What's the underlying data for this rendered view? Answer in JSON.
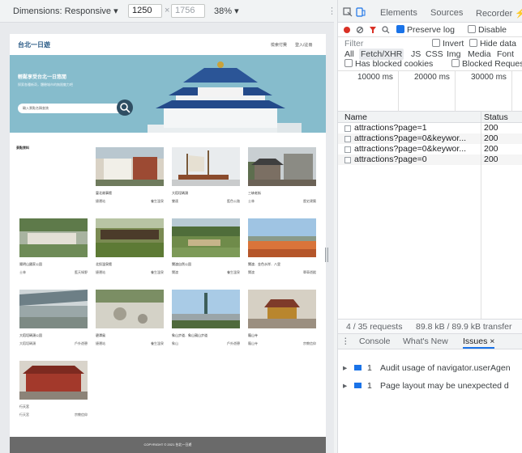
{
  "device_toolbar": {
    "dimensions_label": "Dimensions: Responsive ▾",
    "width_value": "1250",
    "times_sign": "×",
    "height_placeholder": "1756",
    "zoom_label": "38% ▾"
  },
  "site": {
    "logo": "台北一日遊",
    "nav": [
      "檢索付費",
      "登入/註冊"
    ],
    "hero_title": "輕鬆享受台北一日悠閒",
    "hero_subtitle": "探索各種新奇，體驗城市的無限魅力吧",
    "search_placeholder": "輸入景點名稱查詢",
    "section_title": "景點資料",
    "cards": [
      {
        "name": "臺北故事館",
        "mrt": "捷運站",
        "category": "養生溫泉"
      },
      {
        "name": "大稻埕碼頭",
        "mrt": "雙連",
        "category": "藍色公路"
      },
      {
        "name": "三峽老街",
        "mrt": "士林",
        "category": "歷史建築"
      },
      {
        "name": "陽明山國家公園",
        "mrt": "士林",
        "category": "藍天綠野"
      },
      {
        "name": "北投溫泉館",
        "mrt": "捷運站",
        "category": "養生溫泉"
      },
      {
        "name": "關渡自然公園",
        "mrt": "關渡",
        "category": "養生溫泉"
      },
      {
        "name": "關渡．金色水岸．八里",
        "mrt": "關渡",
        "category": "單車遊蹤"
      },
      {
        "name": "大稻埕碼頭公園",
        "mrt": "大稻埕碼頭",
        "category": "戶外遊憩"
      },
      {
        "name": "碧潭風",
        "mrt": "捷運站",
        "category": "養生溫泉"
      },
      {
        "name": "象山步道．象山親山步道",
        "mrt": "象山",
        "category": "戶外遊憩"
      },
      {
        "name": "龍山寺",
        "mrt": "龍山寺",
        "category": "宗教信仰"
      },
      {
        "name": "行天宮",
        "mrt": "行天宮",
        "category": "宗教信仰"
      }
    ],
    "footer": "COPYRIGHT © 2021 台北一日遊"
  },
  "devtools": {
    "tabs": [
      "Elements",
      "Sources",
      "Recorder ⚡"
    ],
    "preserve_log": "Preserve log",
    "disable_cache": "Disable",
    "filter_placeholder": "Filter",
    "invert": "Invert",
    "hide_data": "Hide data",
    "types": [
      "All",
      "Fetch/XHR",
      "JS",
      "CSS",
      "Img",
      "Media",
      "Font"
    ],
    "has_blocked_cookies": "Has blocked cookies",
    "blocked_requests": "Blocked Reques",
    "timeline_ticks": [
      "10000 ms",
      "20000 ms",
      "30000 ms"
    ],
    "columns": {
      "name": "Name",
      "status": "Status"
    },
    "requests": [
      {
        "name": "attractions?page=1",
        "status": "200"
      },
      {
        "name": "attractions?page=0&keywor...",
        "status": "200"
      },
      {
        "name": "attractions?page=0&keywor...",
        "status": "200"
      },
      {
        "name": "attractions?page=0",
        "status": "200"
      }
    ],
    "summary": "4 / 35 requests",
    "transferred": "89.8 kB / 89.9 kB transfer",
    "drawer_tabs": [
      "Console",
      "What's New",
      "Issues ×"
    ],
    "issues": [
      {
        "count": "1",
        "text": "Audit usage of navigator.userAgen"
      },
      {
        "count": "1",
        "text": "Page layout may be unexpected d"
      }
    ]
  },
  "colors": {
    "accent": "#1a73e8",
    "hero": "#7fb6c9",
    "footer": "#6a6a6a",
    "logo": "#2a5b86"
  }
}
